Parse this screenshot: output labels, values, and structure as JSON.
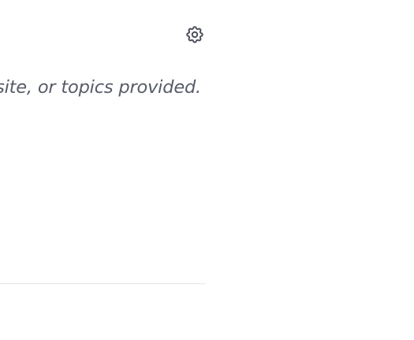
{
  "panel": {
    "settings_icon": "gear-icon",
    "settings_label": "Settings",
    "empty_message": "site, or topics provided.",
    "icon_color": "#4a4f5a",
    "text_color": "#565b66",
    "divider_color": "#e5e6e9"
  }
}
